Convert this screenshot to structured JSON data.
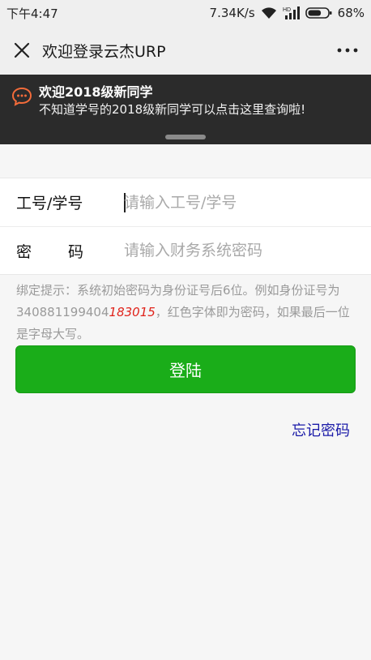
{
  "status_bar": {
    "time": "下午4:47",
    "network_speed": "7.34K/s",
    "signal_label": "HD",
    "battery": "68%",
    "battery_level": 0.68
  },
  "nav": {
    "title": "欢迎登录云杰URP",
    "icons": {
      "close": "close-icon",
      "more": "more-icon"
    }
  },
  "notice": {
    "title": "欢迎2018级新同学",
    "desc": "不知道学号的2018级新同学可以点击这里查询啦!",
    "icon": "chat-bubble-icon"
  },
  "form": {
    "username": {
      "label": "工号/学号",
      "placeholder": "请输入工号/学号",
      "value": ""
    },
    "password": {
      "label_1": "密",
      "label_2": "码",
      "placeholder": "请输入财务系统密码",
      "value": ""
    }
  },
  "hint": {
    "text_before": "绑定提示：系统初始密码为身份证号后6位。例如身份证号为340881199404",
    "highlight": "183015",
    "text_after": "，红色字体即为密码，如果最后一位是字母大写。"
  },
  "login_button": "登陆",
  "forgot_link": "忘记密码",
  "colors": {
    "primary_green": "#1aad19",
    "banner_bg": "#2b2b2b",
    "notice_icon": "#f26b3a",
    "highlight_red": "#e0231b",
    "link_blue": "#1a1aa8"
  }
}
